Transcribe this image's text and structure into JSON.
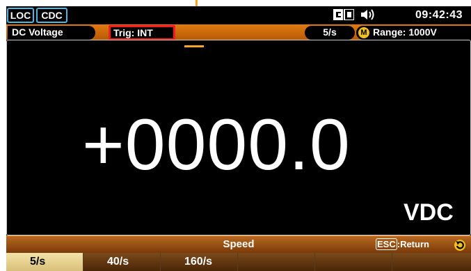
{
  "status_bar": {
    "loc": "LOC",
    "cdc": "CDC",
    "clock": "09:42:43"
  },
  "info_row": {
    "mode": "DC Voltage",
    "trigger": "Trig: INT",
    "rate": "5/s",
    "range_badge": "M",
    "range": "Range:  1000V"
  },
  "display": {
    "reading": "+0000.0",
    "unit": "VDC"
  },
  "menu": {
    "title": "Speed",
    "esc_key": "ESC",
    "esc_action": ":Return"
  },
  "softkeys": [
    "5/s",
    "40/s",
    "160/s",
    "",
    "",
    ""
  ],
  "colors": {
    "callout": "#f5a623",
    "highlight": "#ff1a1a",
    "badge_border": "#4fb6e0"
  }
}
